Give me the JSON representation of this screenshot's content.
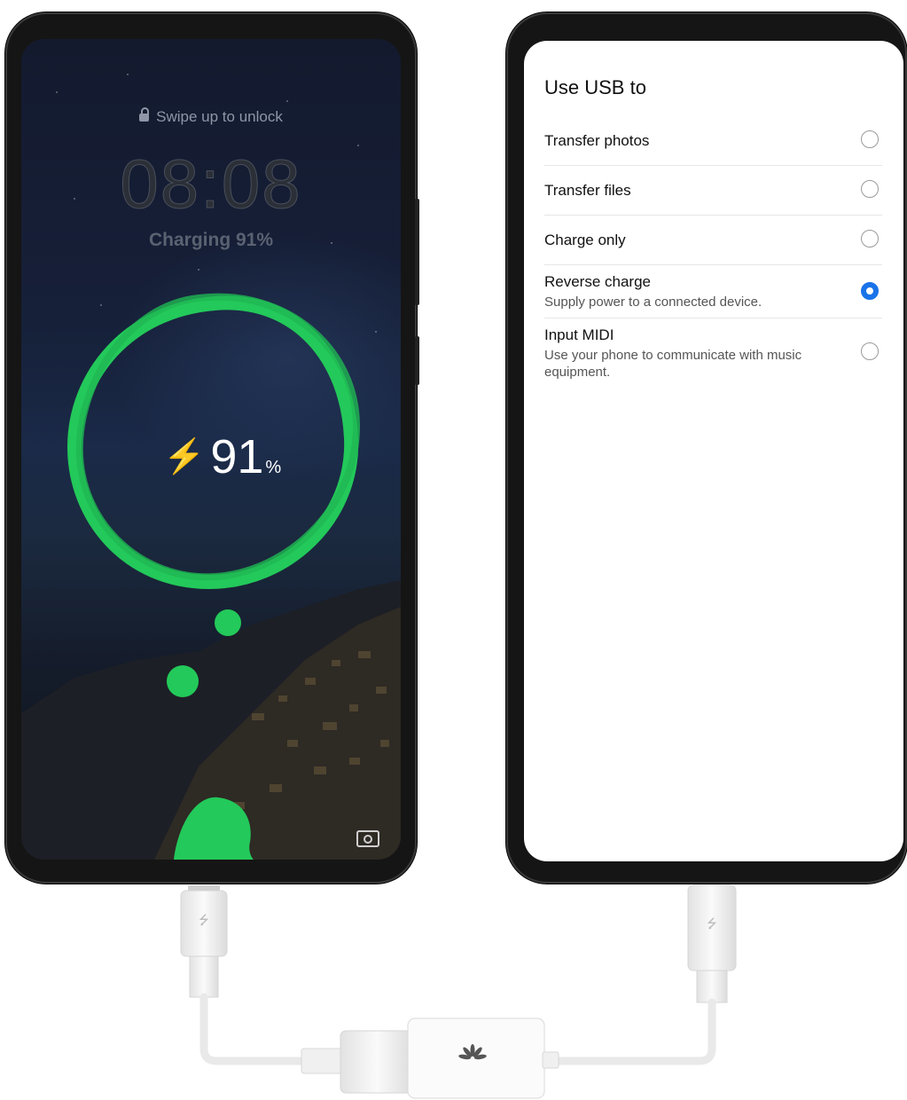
{
  "lock_screen": {
    "hint": "Swipe up to unlock",
    "time": "08:08",
    "charging": "Charging 91%",
    "percent_value": "91",
    "percent_unit": "%",
    "accent_color": "#23c95a"
  },
  "usb_dialog": {
    "title": "Use USB to",
    "options": [
      {
        "label": "Transfer photos",
        "subtitle": "",
        "selected": false
      },
      {
        "label": "Transfer files",
        "subtitle": "",
        "selected": false
      },
      {
        "label": "Charge only",
        "subtitle": "",
        "selected": false
      },
      {
        "label": "Reverse charge",
        "subtitle": "Supply power to a connected device.",
        "selected": true
      },
      {
        "label": "Input MIDI",
        "subtitle": "Use your phone to communicate with music equipment.",
        "selected": false
      }
    ],
    "accent_color": "#1a73e8"
  }
}
